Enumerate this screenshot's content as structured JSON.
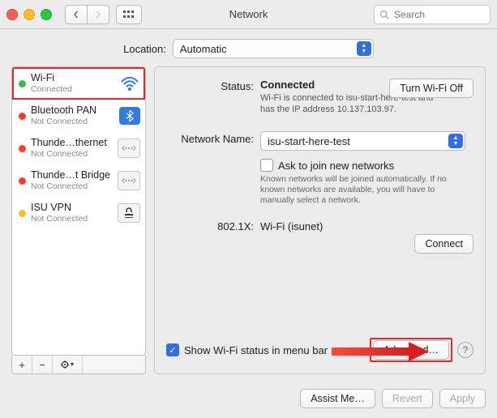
{
  "window": {
    "title": "Network",
    "search_placeholder": "Search"
  },
  "location": {
    "label": "Location:",
    "selected": "Automatic"
  },
  "sidebar": {
    "items": [
      {
        "name": "Wi-Fi",
        "status": "Connected",
        "dot": "green"
      },
      {
        "name": "Bluetooth PAN",
        "status": "Not Connected",
        "dot": "red"
      },
      {
        "name": "Thunde…thernet",
        "status": "Not Connected",
        "dot": "red"
      },
      {
        "name": "Thunde…t Bridge",
        "status": "Not Connected",
        "dot": "red"
      },
      {
        "name": "ISU VPN",
        "status": "Not Connected",
        "dot": "yellow"
      }
    ],
    "add_label": "+",
    "remove_label": "−",
    "gear_label": "✻▾"
  },
  "details": {
    "status_label": "Status:",
    "status_value": "Connected",
    "status_desc": "Wi-Fi is connected to isu-start-here-test and has the IP address 10.137.103.97.",
    "turn_off_label": "Turn Wi-Fi Off",
    "network_name_label": "Network Name:",
    "network_name_value": "isu-start-here-test",
    "ask_join_label": "Ask to join new networks",
    "ask_join_help": "Known networks will be joined automatically. If no known networks are available, you will have to manually select a network.",
    "x8021_label": "802.1X:",
    "x8021_value": "Wi-Fi (isunet)",
    "connect_label": "Connect",
    "show_status_label": "Show Wi-Fi status in menu bar",
    "advanced_label": "Advanced…"
  },
  "footer": {
    "assist": "Assist Me…",
    "revert": "Revert",
    "apply": "Apply"
  }
}
